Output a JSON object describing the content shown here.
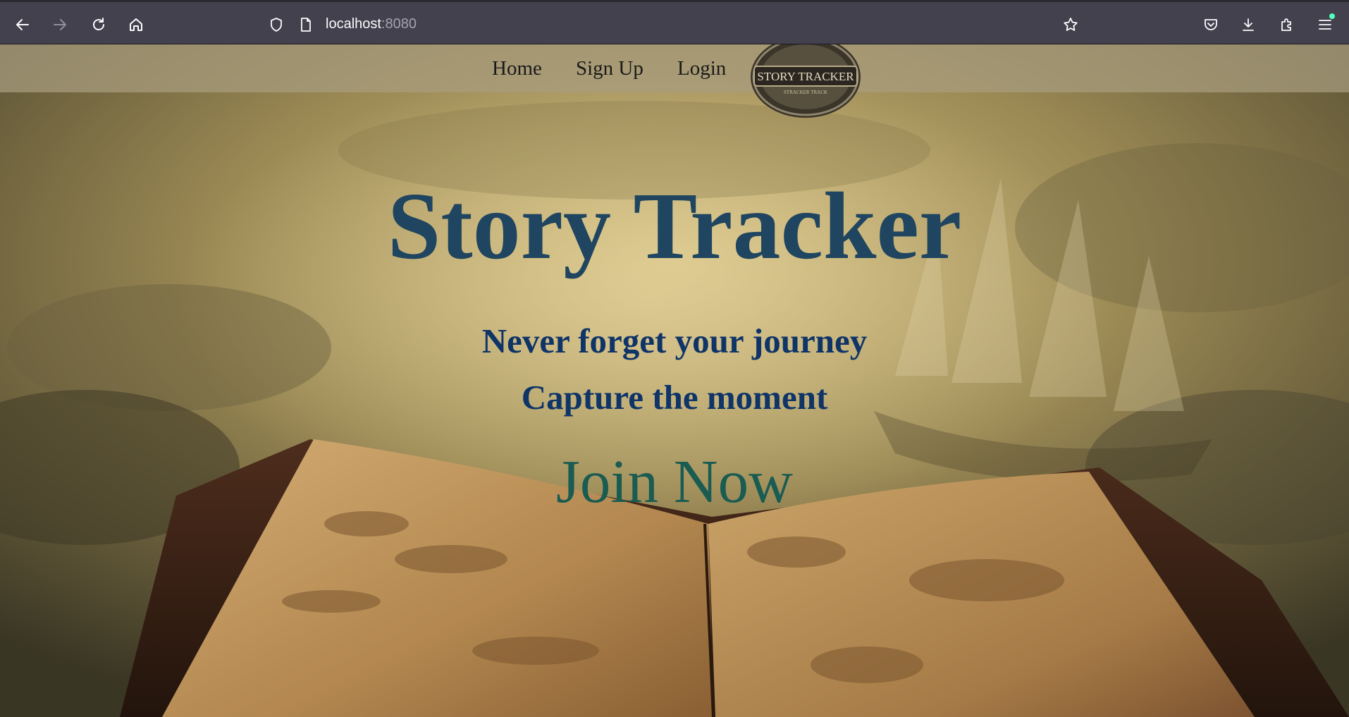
{
  "browser": {
    "url_host": "localhost",
    "url_port": ":8080"
  },
  "nav": {
    "links": [
      "Home",
      "Sign Up",
      "Login"
    ],
    "logo_text": "STORY TRACKER",
    "logo_subtext": "STRACKER TRACK"
  },
  "hero": {
    "title": "Story Tracker",
    "tagline1": "Never forget your journey",
    "tagline2": "Capture the moment",
    "cta": "Join Now"
  },
  "colors": {
    "title": "#1f4560",
    "tagline": "#0f3468",
    "cta": "#1a5b52",
    "chrome": "#42414d"
  }
}
